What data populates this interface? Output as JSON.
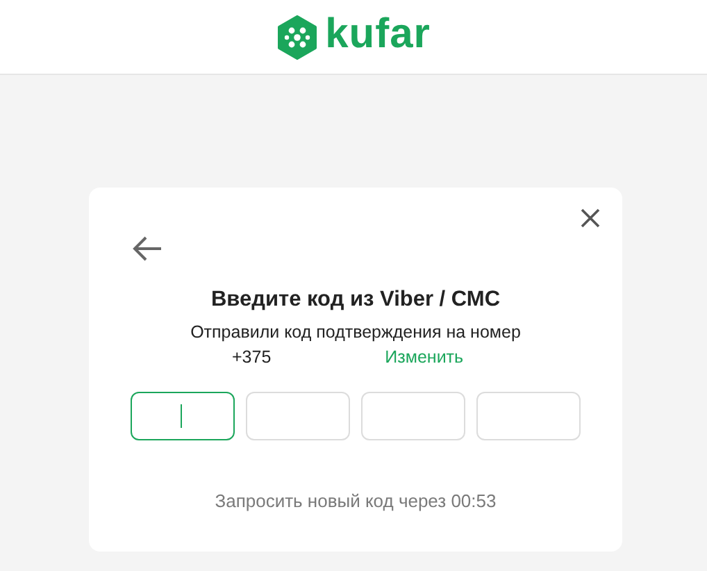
{
  "header": {
    "logo_text": "kufar"
  },
  "dialog": {
    "title": "Введите код из Viber / СМС",
    "subtitle": "Отправили код подтверждения на номер",
    "phone": "+375",
    "change_link": "Изменить",
    "code_inputs": [
      {
        "focused": true
      },
      {
        "focused": false
      },
      {
        "focused": false
      },
      {
        "focused": false
      }
    ],
    "resend_text": "Запросить новый код через 00:53"
  }
}
